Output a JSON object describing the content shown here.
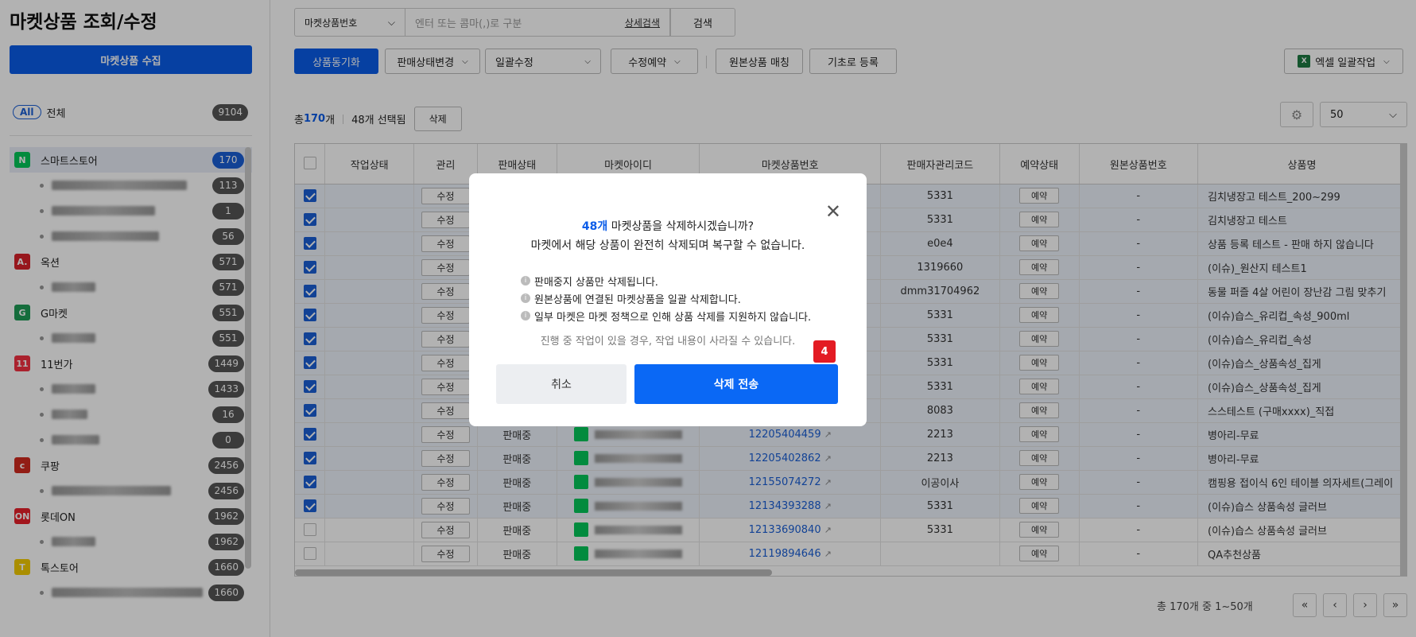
{
  "page_title": "마켓상품 조회/수정",
  "collect_button": "마켓상품 수집",
  "all_filter": {
    "pill": "All",
    "label": "전체",
    "count": "9104"
  },
  "markets": [
    {
      "name": "스마트스토어",
      "count": "170",
      "icon_color": "#03c75a",
      "icon": "N",
      "selected": true
    },
    {
      "sub": true,
      "count": "113"
    },
    {
      "sub": true,
      "count": "1"
    },
    {
      "sub": true,
      "count": "56"
    },
    {
      "name": "옥션",
      "count": "571",
      "icon_color": "#d9222a",
      "icon": "A."
    },
    {
      "sub": true,
      "count": "571"
    },
    {
      "name": "G마켓",
      "count": "551",
      "icon_color": "#1f9c56",
      "icon": "G"
    },
    {
      "sub": true,
      "count": "551"
    },
    {
      "name": "11번가",
      "count": "1449",
      "icon_color": "#f43142",
      "icon": "11"
    },
    {
      "sub": true,
      "count": "1433"
    },
    {
      "sub": true,
      "count": "16"
    },
    {
      "sub": true,
      "count": "0"
    },
    {
      "name": "쿠팡",
      "count": "2456",
      "icon_color": "#d22a1f",
      "icon": "c"
    },
    {
      "sub": true,
      "count": "2456"
    },
    {
      "name": "롯데ON",
      "count": "1962",
      "icon_color": "#e8202a",
      "icon": "ON"
    },
    {
      "sub": true,
      "count": "1962"
    },
    {
      "name": "톡스토어",
      "count": "1660",
      "icon_color": "#f4cc00",
      "icon": "T"
    },
    {
      "sub": true,
      "count": "1660"
    }
  ],
  "search": {
    "field": "마켓상품번호",
    "placeholder": "엔터 또는 콤마(,)로 구분",
    "advanced": "상세검색",
    "button": "검색"
  },
  "toolbar": {
    "sync": "상품동기화",
    "status_change": "판매상태변경",
    "bulk_edit": "일괄수정",
    "reserve_edit": "수정예약",
    "match": "원본상품 매칭",
    "register": "기초로 등록",
    "excel": "엑셀 일괄작업"
  },
  "summary": {
    "prefix": "총 ",
    "total": "170",
    "suffix": "개",
    "selected": "48개 선택됨",
    "delete": "삭제"
  },
  "page_size": "50",
  "columns": [
    "작업상태",
    "관리",
    "판매상태",
    "마켓아이디",
    "마켓상품번호",
    "판매자관리코드",
    "예약상태",
    "원본상품번호",
    "상품명"
  ],
  "edit_label": "수정",
  "reserve_label": "예약",
  "rows": [
    {
      "checked": true,
      "status": "",
      "pid": "",
      "code": "5331",
      "orig": "-",
      "name": "김치냉장고 테스트_200~299"
    },
    {
      "checked": true,
      "status": "",
      "pid": "",
      "code": "5331",
      "orig": "-",
      "name": "김치냉장고 테스트"
    },
    {
      "checked": true,
      "status": "",
      "pid": "",
      "code": "e0e4",
      "orig": "-",
      "name": "상품 등록 테스트 - 판매 하지 않습니다"
    },
    {
      "checked": true,
      "status": "",
      "pid": "",
      "code": "1319660",
      "orig": "-",
      "name": "(이슈)_원산지 테스트1"
    },
    {
      "checked": true,
      "status": "",
      "pid": "",
      "code": "dmm31704962",
      "orig": "-",
      "name": "동물 퍼즐 4살 어린이 장난감 그림 맞추기"
    },
    {
      "checked": true,
      "status": "",
      "pid": "",
      "code": "5331",
      "orig": "-",
      "name": "(이슈)습스_유리컵_속성_900ml"
    },
    {
      "checked": true,
      "status": "",
      "pid": "",
      "code": "5331",
      "orig": "-",
      "name": "(이슈)습스_유리컵_속성"
    },
    {
      "checked": true,
      "status": "",
      "pid": "",
      "code": "5331",
      "orig": "-",
      "name": "(이슈)습스_상품속성_집게"
    },
    {
      "checked": true,
      "status": "",
      "pid": "",
      "code": "5331",
      "orig": "-",
      "name": "(이슈)습스_상품속성_집게"
    },
    {
      "checked": true,
      "status": "",
      "pid": "",
      "code": "8083",
      "orig": "-",
      "name": "스스테스트 (구매xxxx)_직접"
    },
    {
      "checked": true,
      "status": "판매중",
      "pid": "12205404459",
      "code": "2213",
      "orig": "-",
      "name": "병아리-무료"
    },
    {
      "checked": true,
      "status": "판매중",
      "pid": "12205402862",
      "code": "2213",
      "orig": "-",
      "name": "병아리-무료"
    },
    {
      "checked": true,
      "status": "판매중",
      "pid": "12155074272",
      "code": "이공이사",
      "orig": "-",
      "name": "캠핑용 접이식 6인 테이블 의자세트(그레이"
    },
    {
      "checked": true,
      "status": "판매중",
      "pid": "12134393288",
      "code": "5331",
      "orig": "-",
      "name": "(이슈)습스 상품속성 글러브"
    },
    {
      "checked": false,
      "status": "판매중",
      "pid": "12133690840",
      "code": "5331",
      "orig": "-",
      "name": "(이슈)습스 상품속성 글러브"
    },
    {
      "checked": false,
      "status": "판매중",
      "pid": "12119894646",
      "code": "",
      "orig": "-",
      "name": "QA추천상품"
    }
  ],
  "pager": {
    "info": "총 170개 중 1~50개",
    "first": "«",
    "prev": "‹",
    "next": "›",
    "last": "»"
  },
  "modal": {
    "count": "48개",
    "line1_rest": " 마켓상품을 삭제하시겠습니까?",
    "line2": "마켓에서 해당 상품이 완전히 삭제되며 복구할 수 없습니다.",
    "notes": [
      "판매중지 상품만 삭제됩니다.",
      "원본상품에 연결된 마켓상품을 일괄 삭제합니다.",
      "일부 마켓은 마켓 정책으로 인해 상품 삭제를 지원하지 않습니다."
    ],
    "warning": "진행 중 작업이 있을 경우, 작업 내용이 사라질 수 있습니다.",
    "cancel": "취소",
    "confirm": "삭제 전송",
    "step": "4"
  }
}
